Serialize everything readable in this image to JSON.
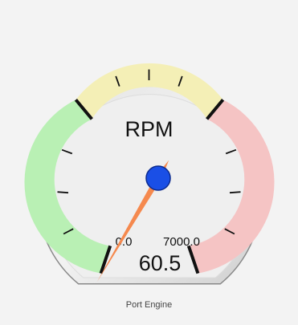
{
  "gauge": {
    "title": "RPM",
    "min_label": "0.0",
    "max_label": "7000.0",
    "min": 0,
    "max": 7000,
    "value": 60.5,
    "value_label": "60.5",
    "caption": "Port Engine",
    "bands": [
      {
        "name": "low",
        "color": "#b9f0b4"
      },
      {
        "name": "normal",
        "color": "#f4efb6"
      },
      {
        "name": "high",
        "color": "#f5c4c4"
      }
    ],
    "needle_color": "#f5894e",
    "hub_color": "#1a4fe6"
  }
}
